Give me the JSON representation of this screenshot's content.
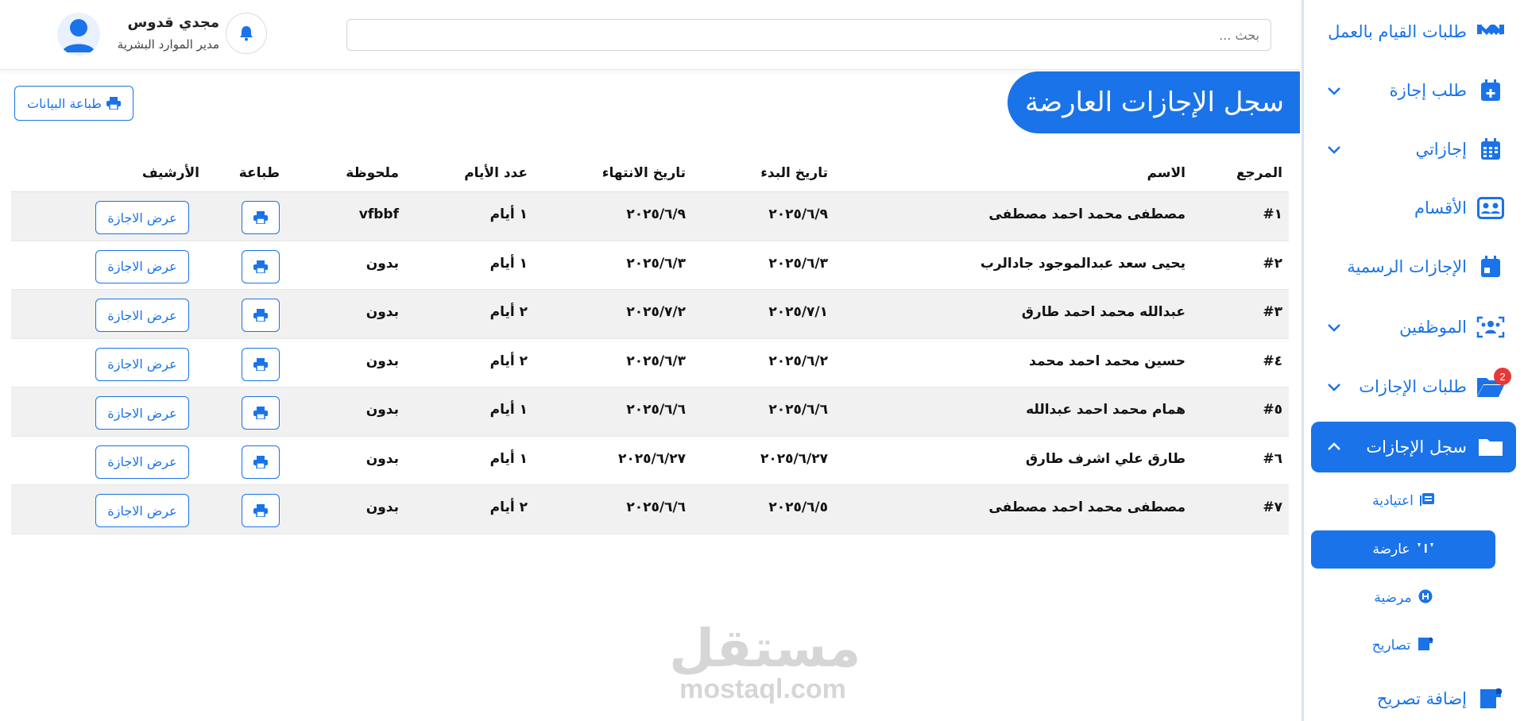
{
  "sidebar": {
    "items": [
      {
        "label": "طلبات القيام بالعمل",
        "icon": "handshake-icon"
      },
      {
        "label": "طلب إجازة",
        "icon": "calendar-plus-icon"
      },
      {
        "label": "إجازاتي",
        "icon": "calendar-icon"
      },
      {
        "label": "الأقسام",
        "icon": "users-card-icon"
      },
      {
        "label": "الإجازات الرسمية",
        "icon": "calendar-day-icon"
      },
      {
        "label": "الموظفين",
        "icon": "users-icon"
      },
      {
        "label": "طلبات الإجازات",
        "icon": "folder-open-icon",
        "badge": "2"
      },
      {
        "label": "سجل الإجازات",
        "icon": "folder-icon"
      }
    ],
    "subitems": [
      {
        "label": "اعتيادية",
        "icon": "list-icon"
      },
      {
        "label": "عارضة",
        "icon": "quote-icon"
      },
      {
        "label": "مرضية",
        "icon": "hospital-icon"
      },
      {
        "label": "تصاريح",
        "icon": "ticket-icon"
      }
    ],
    "add_permit": {
      "label": "إضافة تصريح",
      "icon": "ticket-plus-icon"
    },
    "accent": "#1a73e8"
  },
  "header": {
    "search_placeholder": "بحث ...",
    "user_name": "مجدي قدوس",
    "user_role": "مدير الموارد البشرية"
  },
  "page": {
    "title": "سجل الإجازات العارضة",
    "print_all_label": "طباعة البيانات"
  },
  "table": {
    "headers": {
      "ref": "المرجع",
      "name": "الاسم",
      "start": "تاريخ البدء",
      "end": "تاريخ الانتهاء",
      "days": "عدد الأيام",
      "note": "ملحوظة",
      "print": "طباعة",
      "archive": "الأرشيف"
    },
    "view_label": "عرض الاجازة",
    "rows": [
      {
        "ref": "#١",
        "name": "مصطفى محمد احمد مصطفى",
        "start": "٢٠٢٥/٦/٩",
        "end": "٢٠٢٥/٦/٩",
        "days": "١ أيام",
        "note": "vfbbf"
      },
      {
        "ref": "#٢",
        "name": "يحيى سعد عبدالموجود جادالرب",
        "start": "٢٠٢٥/٦/٣",
        "end": "٢٠٢٥/٦/٣",
        "days": "١ أيام",
        "note": "بدون"
      },
      {
        "ref": "#٣",
        "name": "عبدالله محمد احمد طارق",
        "start": "٢٠٢٥/٧/١",
        "end": "٢٠٢٥/٧/٢",
        "days": "٢ أيام",
        "note": "بدون"
      },
      {
        "ref": "#٤",
        "name": "حسين محمد احمد محمد",
        "start": "٢٠٢٥/٦/٢",
        "end": "٢٠٢٥/٦/٣",
        "days": "٢ أيام",
        "note": "بدون"
      },
      {
        "ref": "#٥",
        "name": "همام محمد احمد عبدالله",
        "start": "٢٠٢٥/٦/٦",
        "end": "٢٠٢٥/٦/٦",
        "days": "١ أيام",
        "note": "بدون"
      },
      {
        "ref": "#٦",
        "name": "طارق علي اشرف طارق",
        "start": "٢٠٢٥/٦/٢٧",
        "end": "٢٠٢٥/٦/٢٧",
        "days": "١ أيام",
        "note": "بدون"
      },
      {
        "ref": "#٧",
        "name": "مصطفى محمد احمد مصطفى",
        "start": "٢٠٢٥/٦/٥",
        "end": "٢٠٢٥/٦/٦",
        "days": "٢ أيام",
        "note": "بدون"
      }
    ]
  },
  "watermark": {
    "arabic": "مستقل",
    "latin": "mostaql.com"
  }
}
